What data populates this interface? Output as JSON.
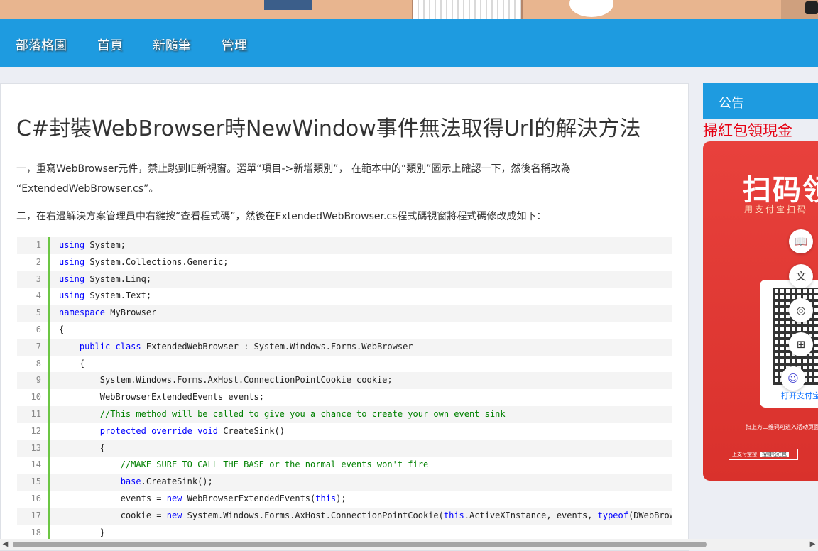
{
  "nav": {
    "items": [
      "部落格園",
      "首頁",
      "新隨筆",
      "管理"
    ]
  },
  "post": {
    "title": "C#封裝WebBrowser時NewWindow事件無法取得Url的解決方法",
    "para1_line1": "一，重寫WebBrowser元件，禁止跳到IE新視窗。選單“項目->新增類別”， 在範本中的“類別”圖示上確認一下，然後名稱改為",
    "para1_line2": "“ExtendedWebBrowser.cs”。",
    "para2": "二，在右邊解決方案管理員中右鍵按“查看程式碼”，然後在ExtendedWebBrowser.cs程式碼視窗將程式碼修改成如下："
  },
  "code_lines": [
    "using System;",
    "using System.Collections.Generic;",
    "using System.Linq;",
    "using System.Text;",
    "namespace MyBrowser",
    "{",
    "    public class ExtendedWebBrowser : System.Windows.Forms.WebBrowser",
    "    {",
    "        System.Windows.Forms.AxHost.ConnectionPointCookie cookie;",
    "        WebBrowserExtendedEvents events;",
    "        //This method will be called to give you a chance to create your own event sink",
    "        protected override void CreateSink()",
    "        {",
    "            //MAKE SURE TO CALL THE BASE or the normal events won't fire",
    "            base.CreateSink();",
    "            events = new WebBrowserExtendedEvents(this);",
    "            cookie = new System.Windows.Forms.AxHost.ConnectionPointCookie(this.ActiveXInstance, events, typeof(DWebBrow",
    "        }"
  ],
  "sidebar": {
    "heading": "公告",
    "red_link": "掃紅包領現金",
    "promo_title": "扫码领",
    "promo_subtitle": "用支付宝扫码",
    "promo_open": "打开支付宝",
    "promo_note": "扫上方二维码可进入活动页面,",
    "promo_bar_left": "上支付宝搜",
    "promo_bar_search": "搜赚钱红包"
  },
  "colors": {
    "nav_bg": "#1e9be0",
    "gutter_line": "#6cc644",
    "keyword": "#0000ff",
    "comment": "#008000",
    "red_link": "#e60012"
  }
}
